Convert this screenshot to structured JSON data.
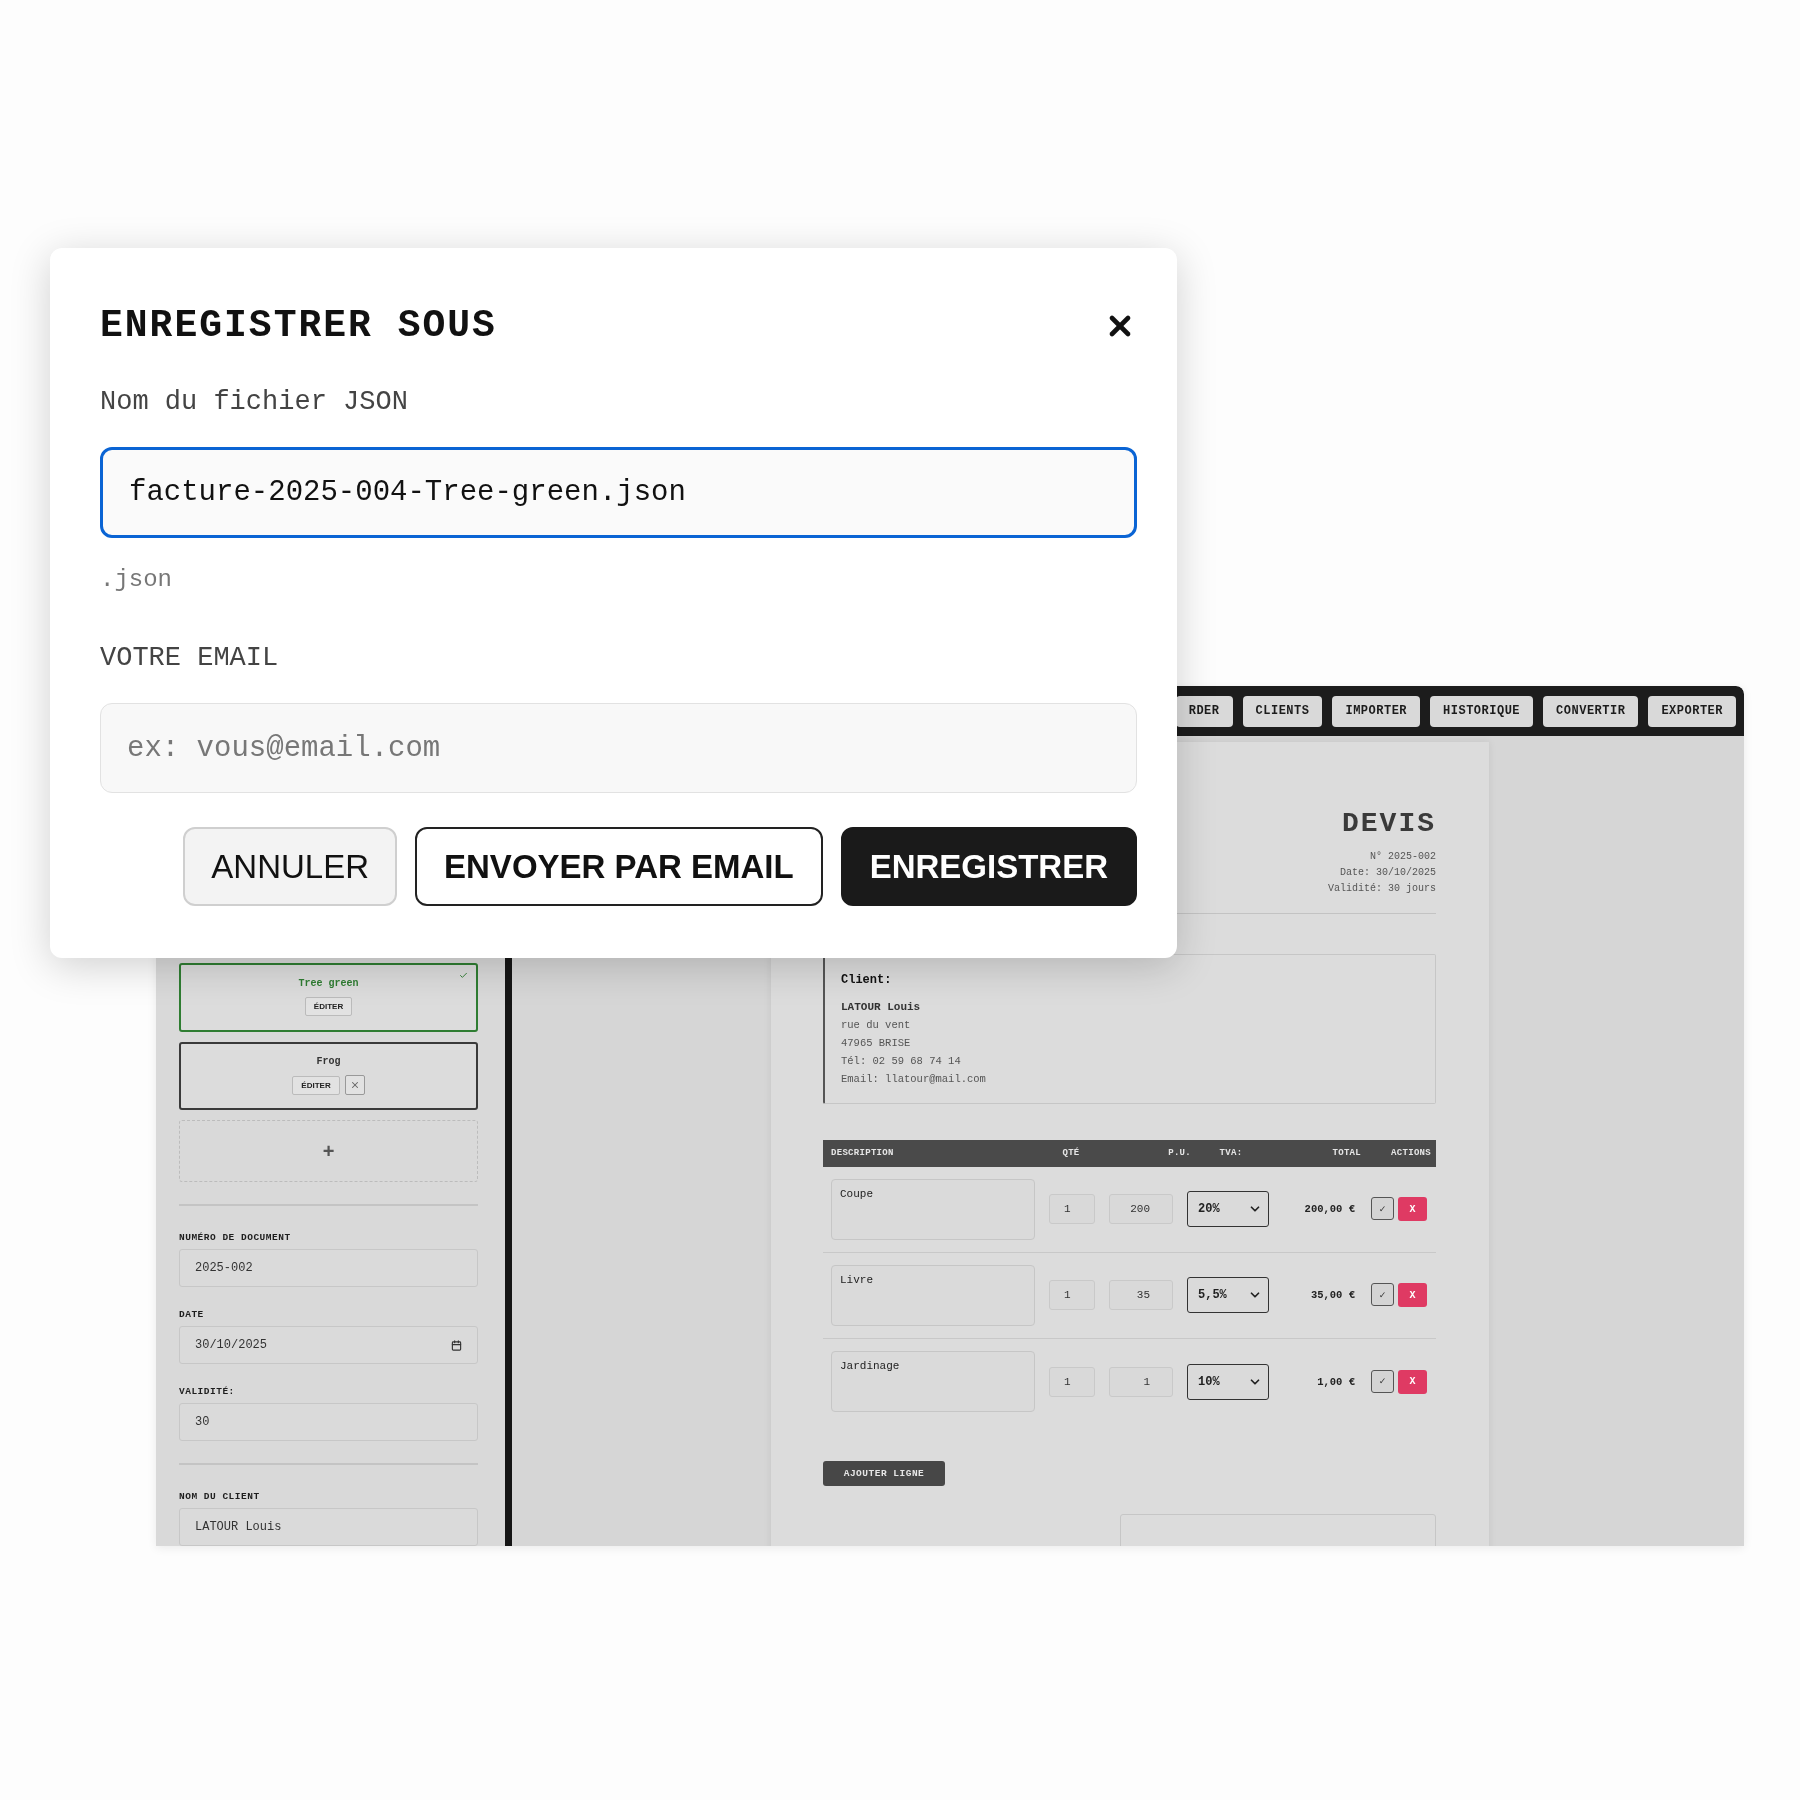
{
  "app": {
    "nav": [
      {
        "label": "RDER"
      },
      {
        "label": "CLIENTS"
      },
      {
        "label": "IMPORTER"
      },
      {
        "label": "HISTORIQUE"
      },
      {
        "label": "CONVERTIR"
      },
      {
        "label": "EXPORTER"
      }
    ],
    "templates": [
      {
        "name": "Tree green",
        "edit": "ÉDITER",
        "selected": true
      },
      {
        "name": "Frog",
        "edit": "ÉDITER",
        "selected": false
      }
    ],
    "add_template": "+",
    "field_groups": [
      [
        {
          "kind": "text",
          "label": "NUMÉRO DE DOCUMENT",
          "value": "2025-002"
        },
        {
          "kind": "date",
          "label": "DATE",
          "value": "30/10/2025"
        },
        {
          "kind": "text",
          "label": "VALIDITÉ:",
          "value": "30"
        }
      ],
      [
        {
          "kind": "text",
          "label": "NOM DU CLIENT",
          "value": "LATOUR Louis"
        }
      ]
    ],
    "document": {
      "title": "DEVIS",
      "meta": [
        "N° 2025-002",
        "Date: 30/10/2025",
        "Validité: 30 jours"
      ],
      "client": {
        "heading": "Client:",
        "name": "LATOUR Louis",
        "lines": [
          "rue du vent",
          "47965 BRISE",
          "Tél: 02 59 68 74 14",
          "Email: llatour@mail.com"
        ]
      },
      "columns": [
        "DESCRIPTION",
        "QTÉ",
        "P.U.",
        "TVA:",
        "TOTAL",
        "ACTIONS"
      ],
      "rows": [
        {
          "description": "Coupe",
          "qty": "1",
          "unit_price": "200",
          "tva": "20%",
          "total": "200,00 €",
          "confirm": "✓",
          "delete": "X"
        },
        {
          "description": "Livre",
          "qty": "1",
          "unit_price": "35",
          "tva": "5,5%",
          "total": "35,00 €",
          "confirm": "✓",
          "delete": "X"
        },
        {
          "description": "Jardinage",
          "qty": "1",
          "unit_price": "1",
          "tva": "10%",
          "total": "1,00 €",
          "confirm": "✓",
          "delete": "X"
        }
      ],
      "add_line": "AJOUTER LIGNE"
    }
  },
  "dialog": {
    "title": "ENREGISTRER SOUS",
    "filename_label": "Nom du fichier JSON",
    "filename": {
      "value": "facture-2025-004-Tree-green.json",
      "focused": true
    },
    "extension": ".json",
    "email_label": "VOTRE EMAIL",
    "email": {
      "placeholder": "ex: vous@email.com"
    },
    "buttons": [
      {
        "label": "ANNULER",
        "kind": "secondary"
      },
      {
        "label": "ENVOYER PAR EMAIL",
        "kind": "outline"
      },
      {
        "label": "ENREGISTRER",
        "kind": "primary"
      }
    ]
  }
}
